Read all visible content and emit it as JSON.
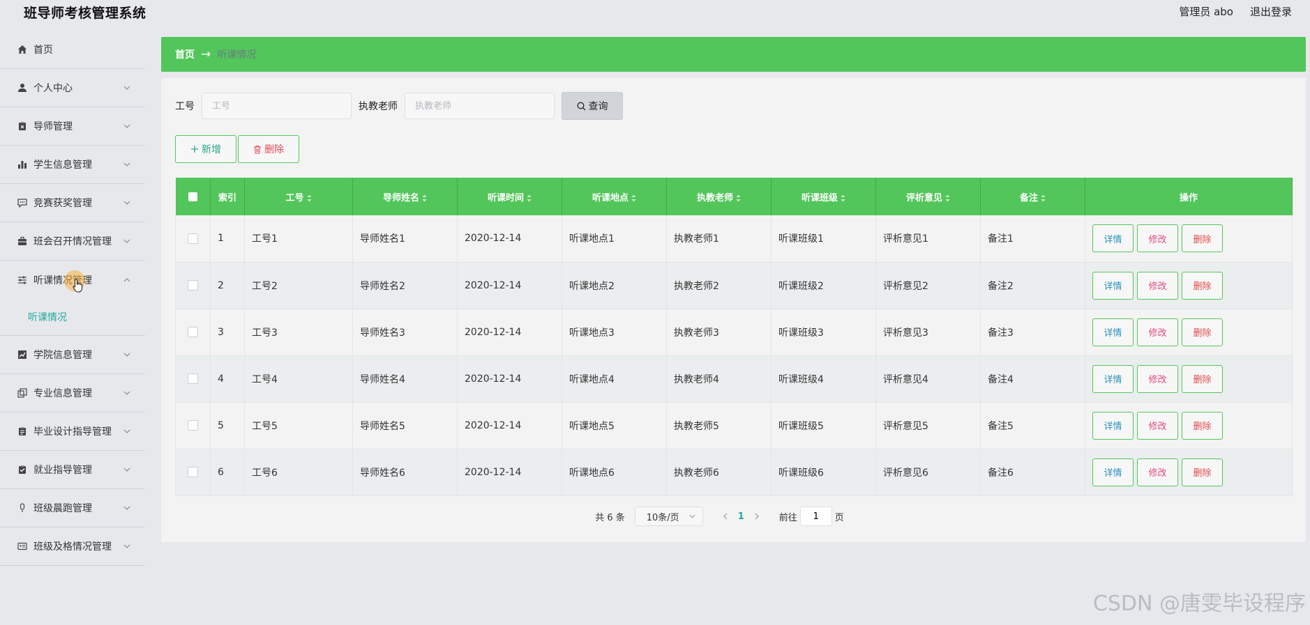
{
  "app": {
    "title": "班导师考核管理系统",
    "user": "管理员 abo",
    "logout": "退出登录"
  },
  "sidebar": {
    "items": [
      {
        "label": "首页",
        "icon": "home-icon"
      },
      {
        "label": "个人中心",
        "icon": "person-icon"
      },
      {
        "label": "导师管理",
        "icon": "clipboard-icon"
      },
      {
        "label": "学生信息管理",
        "icon": "bar-chart-icon"
      },
      {
        "label": "竞赛获奖管理",
        "icon": "chat-icon"
      },
      {
        "label": "班会召开情况管理",
        "icon": "briefcase-icon"
      },
      {
        "label": "听课情况管理",
        "icon": "sliders-icon"
      },
      {
        "label": "学院信息管理",
        "icon": "trend-icon"
      },
      {
        "label": "专业信息管理",
        "icon": "copy-icon"
      },
      {
        "label": "毕业设计指导管理",
        "icon": "clipboard-icon"
      },
      {
        "label": "就业指导管理",
        "icon": "check-clipboard-icon"
      },
      {
        "label": "班级晨跑管理",
        "icon": "microphone-icon"
      },
      {
        "label": "班级及格情况管理",
        "icon": "id-card-icon"
      }
    ],
    "subitem": "听课情况"
  },
  "breadcrumb": {
    "home": "首页",
    "arrow": "→",
    "current": "听课情况"
  },
  "search": {
    "job_label": "工号",
    "job_placeholder": "工号",
    "teacher_label": "执教老师",
    "teacher_placeholder": "执教老师",
    "query_label": "查询"
  },
  "actions": {
    "add_label": "新增",
    "delete_label": "删除"
  },
  "table": {
    "headers": [
      "索引",
      "工号",
      "导师姓名",
      "听课时间",
      "听课地点",
      "执教老师",
      "听课班级",
      "评析意见",
      "备注",
      "操作"
    ],
    "rows": [
      [
        "1",
        "工号1",
        "导师姓名1",
        "2020-12-14",
        "听课地点1",
        "执教老师1",
        "听课班级1",
        "评析意见1",
        "备注1"
      ],
      [
        "2",
        "工号2",
        "导师姓名2",
        "2020-12-14",
        "听课地点2",
        "执教老师2",
        "听课班级2",
        "评析意见2",
        "备注2"
      ],
      [
        "3",
        "工号3",
        "导师姓名3",
        "2020-12-14",
        "听课地点3",
        "执教老师3",
        "听课班级3",
        "评析意见3",
        "备注3"
      ],
      [
        "4",
        "工号4",
        "导师姓名4",
        "2020-12-14",
        "听课地点4",
        "执教老师4",
        "听课班级4",
        "评析意见4",
        "备注4"
      ],
      [
        "5",
        "工号5",
        "导师姓名5",
        "2020-12-14",
        "听课地点5",
        "执教老师5",
        "听课班级5",
        "评析意见5",
        "备注5"
      ],
      [
        "6",
        "工号6",
        "导师姓名6",
        "2020-12-14",
        "听课地点6",
        "执教老师6",
        "听课班级6",
        "评析意见6",
        "备注6"
      ]
    ],
    "row_buttons": {
      "detail": "详情",
      "edit": "修改",
      "remove": "删除"
    }
  },
  "pagination": {
    "total": "共 6 条",
    "page_size": "10条/页",
    "current_page": "1",
    "goto_prefix": "前往",
    "goto_value": "1",
    "goto_suffix": "页"
  },
  "watermark": "CSDN @唐雯毕设程序",
  "colors": {
    "accent": "#52c65a",
    "sub_active": "#23a99b",
    "danger": "#e34a55"
  }
}
